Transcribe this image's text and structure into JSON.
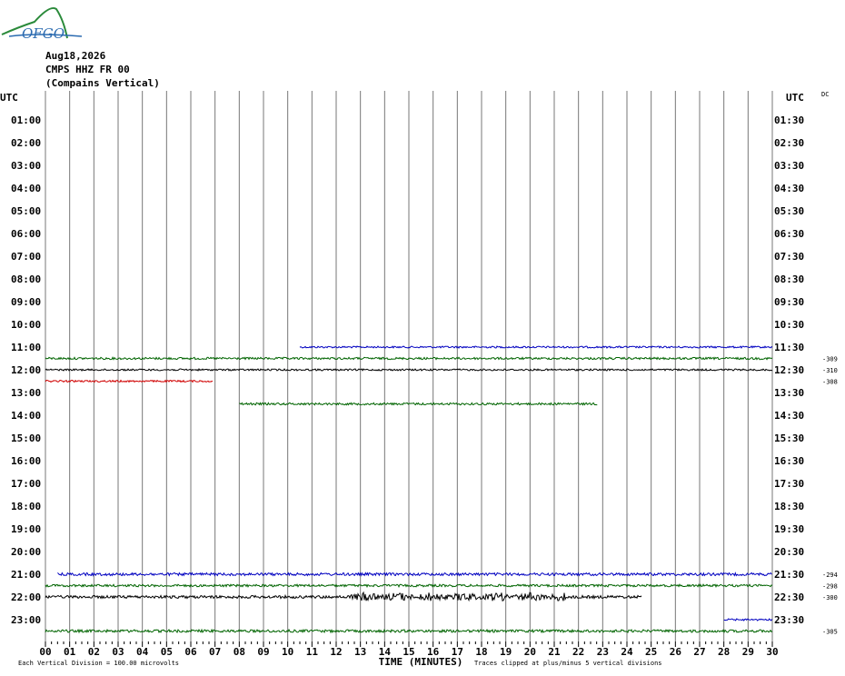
{
  "header": {
    "date": "Aug18,2026",
    "station": "CMPS HHZ FR 00",
    "location": "(Compains Vertical)",
    "logo_text": "OFGO"
  },
  "footer": {
    "division_note": "Each Vertical Division =  100.00 microvolts",
    "axis_title": "TIME (MINUTES)",
    "clip_note": "Traces clipped at plus/minus 5 vertical divisions"
  },
  "colors": {
    "blue": "#0000c0",
    "green": "#006400",
    "black": "#000000",
    "red": "#d00000",
    "grid": "#777777"
  },
  "chart_data": {
    "type": "line",
    "title": "CMPS HHZ FR 00",
    "xlabel": "TIME (MINUTES)",
    "left_axis_label": "UTC",
    "right_axis_label": "UTC",
    "dc_label": "DC",
    "xlim": [
      0,
      30
    ],
    "x_ticks": [
      "00",
      "01",
      "02",
      "03",
      "04",
      "05",
      "06",
      "07",
      "08",
      "09",
      "10",
      "11",
      "12",
      "13",
      "14",
      "15",
      "16",
      "17",
      "18",
      "19",
      "20",
      "21",
      "22",
      "23",
      "24",
      "25",
      "26",
      "27",
      "28",
      "29",
      "30"
    ],
    "left_ticks": [
      "01:00",
      "02:00",
      "03:00",
      "04:00",
      "05:00",
      "06:00",
      "07:00",
      "08:00",
      "09:00",
      "10:00",
      "11:00",
      "12:00",
      "13:00",
      "14:00",
      "15:00",
      "16:00",
      "17:00",
      "18:00",
      "19:00",
      "20:00",
      "21:00",
      "22:00",
      "23:00"
    ],
    "right_ticks": [
      "01:30",
      "02:30",
      "03:30",
      "04:30",
      "05:30",
      "06:30",
      "07:30",
      "08:30",
      "09:30",
      "10:30",
      "11:30",
      "12:30",
      "13:30",
      "14:30",
      "15:30",
      "16:30",
      "17:30",
      "18:30",
      "19:30",
      "20:30",
      "21:30",
      "22:30",
      "23:30"
    ],
    "dc_offsets": [
      {
        "row": 11.5,
        "value": "-309"
      },
      {
        "row": 12.0,
        "value": "-310"
      },
      {
        "row": 12.5,
        "value": "-308"
      },
      {
        "row": 21.0,
        "value": "-294"
      },
      {
        "row": 21.5,
        "value": "-298"
      },
      {
        "row": 22.0,
        "value": "-300"
      },
      {
        "row": 23.5,
        "value": "-305"
      }
    ],
    "traces": [
      {
        "row": 11.0,
        "color": "blue",
        "start": 10.5,
        "end": 30,
        "amp": 1.0
      },
      {
        "row": 11.5,
        "color": "green",
        "start": 0,
        "end": 30,
        "amp": 1.2
      },
      {
        "row": 12.0,
        "color": "black",
        "start": 0,
        "end": 30,
        "amp": 1.0
      },
      {
        "row": 12.5,
        "color": "red",
        "start": 0,
        "end": 6.9,
        "amp": 1.0
      },
      {
        "row": 13.5,
        "color": "green",
        "start": 8.0,
        "end": 22.8,
        "amp": 1.2
      },
      {
        "row": 21.0,
        "color": "blue",
        "start": 0.5,
        "end": 30,
        "amp": 1.5
      },
      {
        "row": 21.5,
        "color": "green",
        "start": 0,
        "end": 30,
        "amp": 1.3
      },
      {
        "row": 22.0,
        "color": "black",
        "start": 0,
        "end": 24.6,
        "amp": 1.6,
        "event_start": 12.5,
        "event_end": 21.5,
        "event_amp": 5.0
      },
      {
        "row": 23.0,
        "color": "blue",
        "start": 28.0,
        "end": 30,
        "amp": 1.0
      },
      {
        "row": 23.5,
        "color": "green",
        "start": 0,
        "end": 30,
        "amp": 1.5
      }
    ]
  }
}
